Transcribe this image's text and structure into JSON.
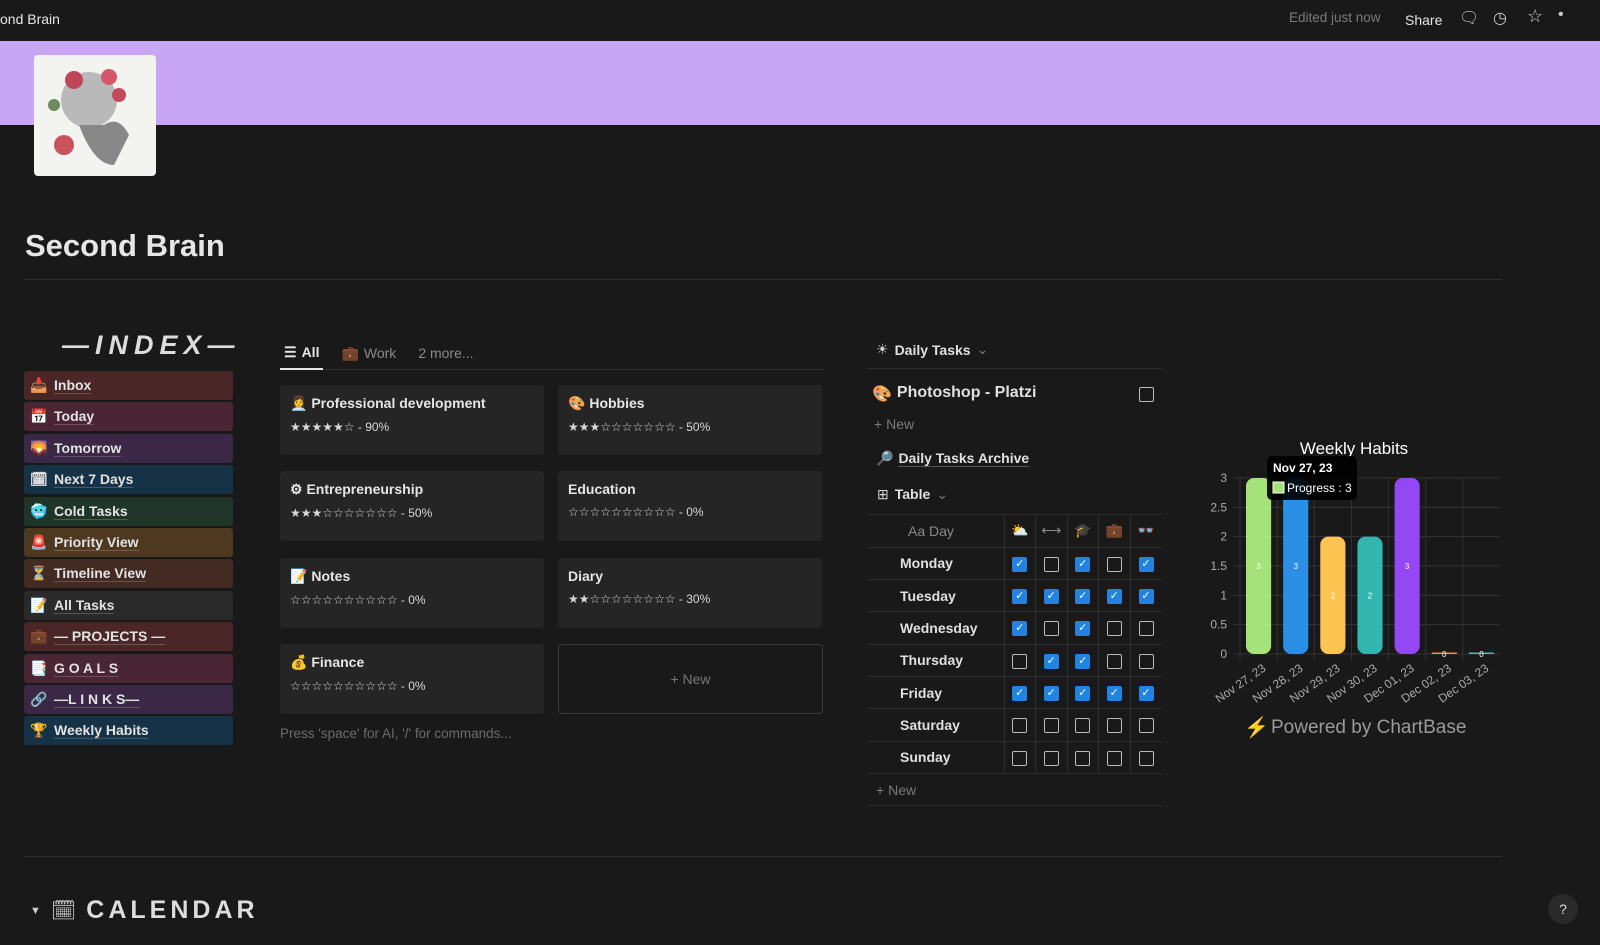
{
  "topbar": {
    "title": "ond Brain",
    "edited": "Edited just now",
    "share": "Share"
  },
  "page": {
    "title": "Second Brain"
  },
  "index": {
    "title": "—INDEX—",
    "items": [
      {
        "label": "Inbox",
        "icon": "📥",
        "color": "#4a2726"
      },
      {
        "label": "Today",
        "icon": "📅",
        "color": "#4a2533"
      },
      {
        "label": "Tomorrow",
        "icon": "🌄",
        "color": "#3a2846"
      },
      {
        "label": "Next 7 Days",
        "icon": "🗓",
        "color": "#163247"
      },
      {
        "label": "Cold Tasks",
        "icon": "🥶",
        "color": "#1f3529"
      },
      {
        "label": "Priority View",
        "icon": "🚨",
        "color": "#4e3920"
      },
      {
        "label": "Timeline View",
        "icon": "⏳",
        "color": "#432a22"
      },
      {
        "label": "All Tasks",
        "icon": "📝",
        "color": "#2a2a2a"
      },
      {
        "label": "— PROJECTS —",
        "icon": "💼",
        "color": "#4a2726"
      },
      {
        "label": "G O A L S",
        "icon": "📑",
        "color": "#4a2533"
      },
      {
        "label": "—L I N K S—",
        "icon": "🔗",
        "color": "#3a2846"
      },
      {
        "label": "Weekly Habits",
        "icon": "🏆",
        "color": "#163247"
      }
    ]
  },
  "gallery": {
    "tabs": [
      "All",
      "Work",
      "2 more..."
    ],
    "cards": [
      {
        "title": "Professional development",
        "icon": "👩‍💼",
        "rating": "★★★★★☆ - 90%"
      },
      {
        "title": "Hobbies",
        "icon": "🎨",
        "rating": "★★★☆☆☆☆☆☆☆ - 50%"
      },
      {
        "title": "Entrepreneurship",
        "icon": "⚙",
        "rating": "★★★☆☆☆☆☆☆☆ - 50%"
      },
      {
        "title": "Education",
        "icon": "",
        "rating": "☆☆☆☆☆☆☆☆☆☆ - 0%"
      },
      {
        "title": "Notes",
        "icon": "📝",
        "rating": "☆☆☆☆☆☆☆☆☆☆ - 0%"
      },
      {
        "title": "Diary",
        "icon": "",
        "rating": "★★☆☆☆☆☆☆☆☆ - 30%"
      },
      {
        "title": "Finance",
        "icon": "💰",
        "rating": "☆☆☆☆☆☆☆☆☆☆ - 0%"
      }
    ],
    "new": "New",
    "hint": "Press 'space' for AI, '/' for commands..."
  },
  "daily": {
    "title": "Daily Tasks",
    "task": "Photoshop - Platzi",
    "new": "New",
    "archive": "Daily Tasks Archive",
    "view": "Table",
    "day_header": "Aa Day",
    "rows": [
      {
        "day": "Monday",
        "checks": [
          true,
          false,
          true,
          false,
          true
        ]
      },
      {
        "day": "Tuesday",
        "checks": [
          true,
          true,
          true,
          true,
          true
        ]
      },
      {
        "day": "Wednesday",
        "checks": [
          true,
          false,
          true,
          false,
          false
        ]
      },
      {
        "day": "Thursday",
        "checks": [
          false,
          true,
          true,
          false,
          false
        ]
      },
      {
        "day": "Friday",
        "checks": [
          true,
          true,
          true,
          true,
          true
        ]
      },
      {
        "day": "Saturday",
        "checks": [
          false,
          false,
          false,
          false,
          false
        ]
      },
      {
        "day": "Sunday",
        "checks": [
          false,
          false,
          false,
          false,
          false
        ]
      }
    ],
    "new_row": "New"
  },
  "chart_data": {
    "type": "bar",
    "title": "Weekly Habits",
    "categories": [
      "Nov 27, 23",
      "Nov 28, 23",
      "Nov 29, 23",
      "Nov 30, 23",
      "Dec 01, 23",
      "Dec 02, 23",
      "Dec 03, 23"
    ],
    "series": [
      {
        "name": "Progress",
        "values": [
          3,
          3,
          2,
          2,
          3,
          0,
          0
        ]
      }
    ],
    "colors": [
      "#a5e27a",
      "#2b8fe6",
      "#fec452",
      "#33b5b0",
      "#9448f3",
      "#f08c4a",
      "#3fbfa3"
    ],
    "ylim": [
      0,
      3
    ],
    "yticks": [
      "0",
      "0.5",
      "1",
      "1.5",
      "2",
      "2.5",
      "3"
    ],
    "tooltip": {
      "title": "Nov 27, 23",
      "text": "Progress : 3"
    },
    "footer": "Powered by ChartBase"
  },
  "calendar": {
    "title": "CALENDAR"
  }
}
